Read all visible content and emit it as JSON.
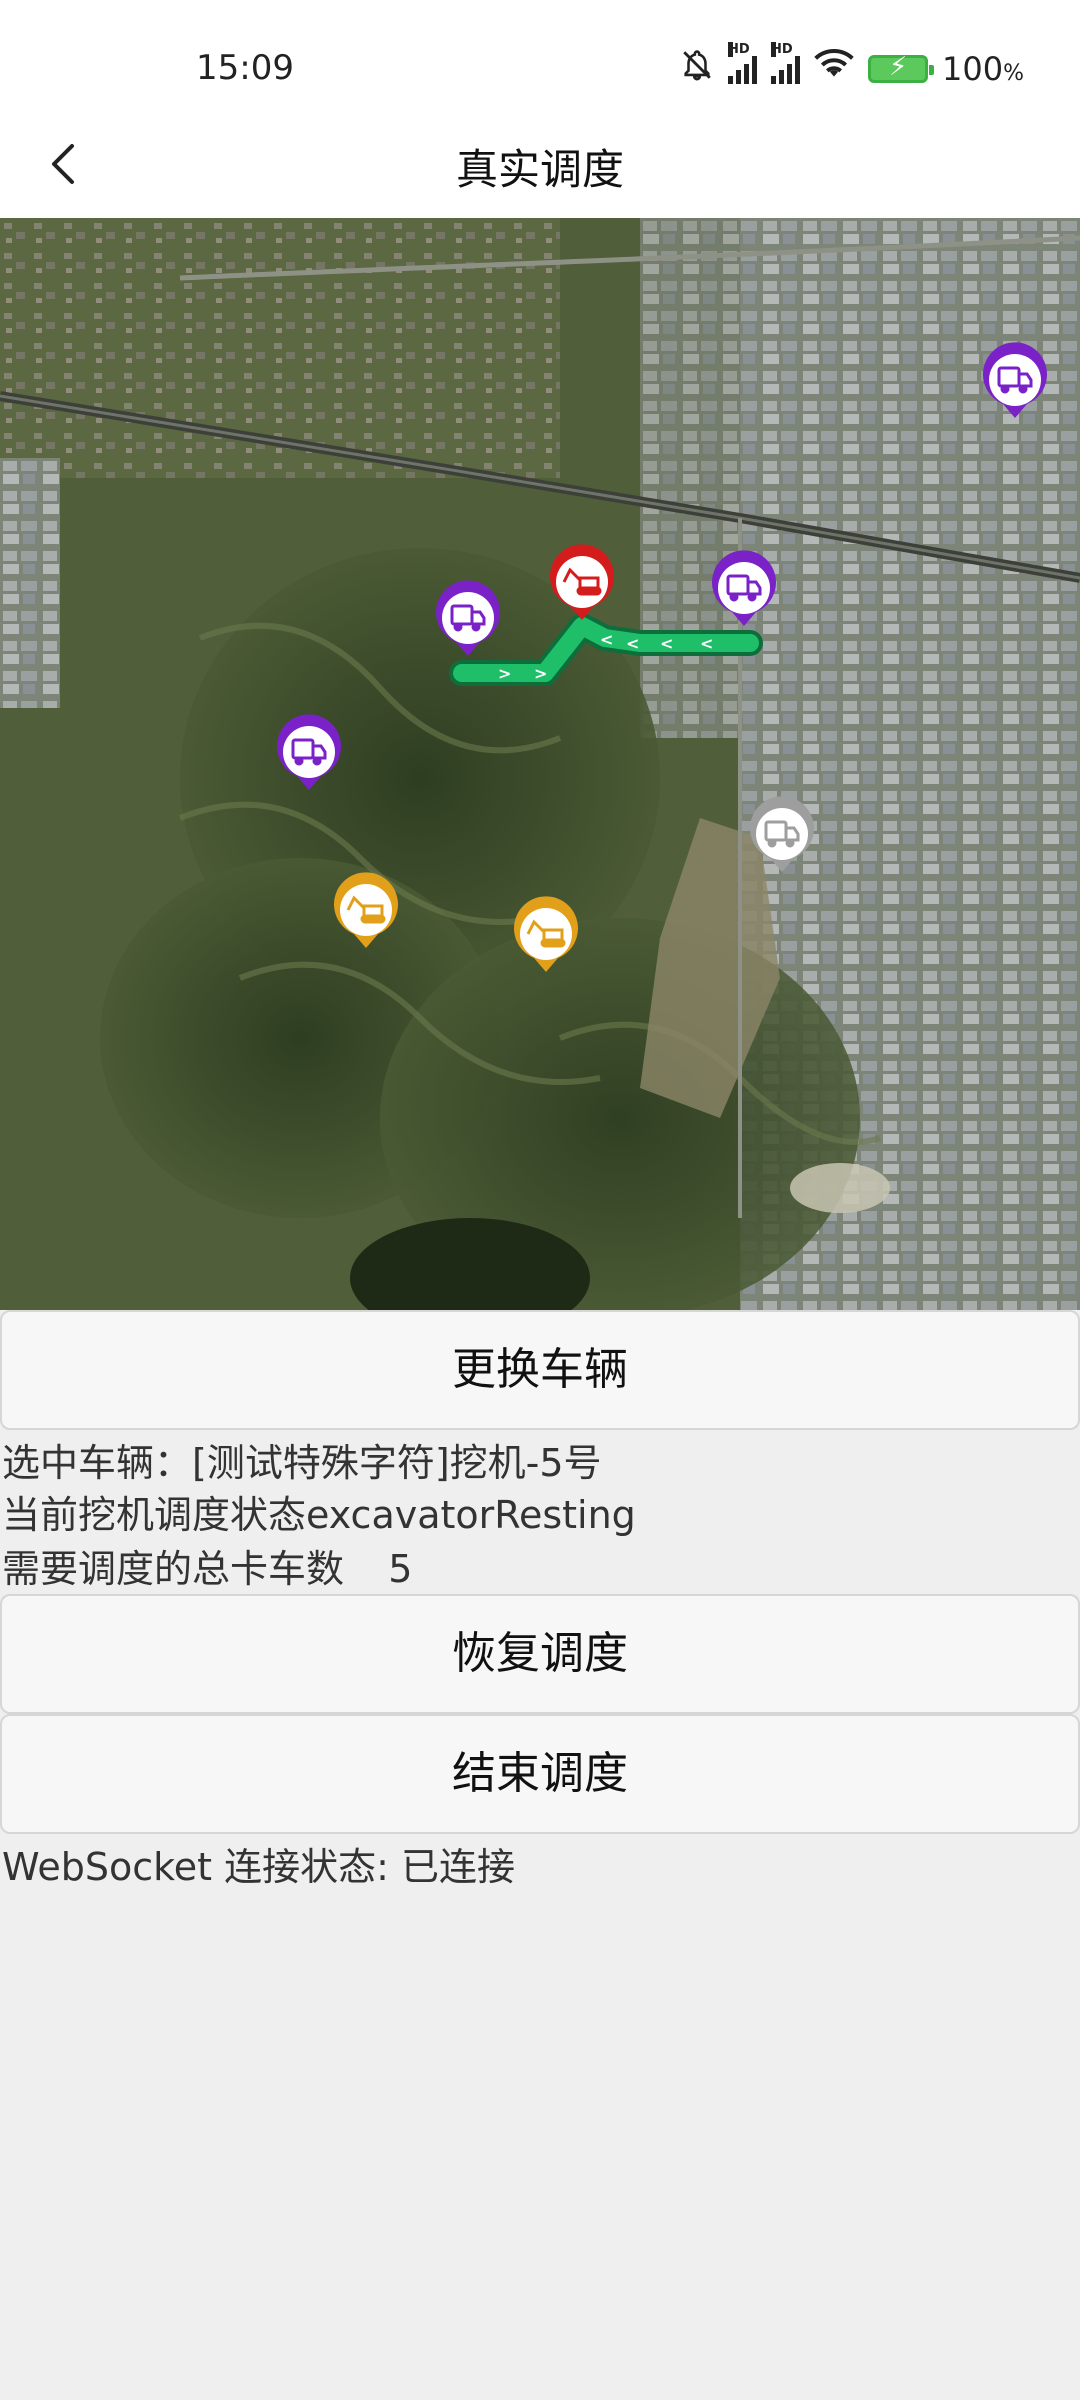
{
  "status_bar": {
    "time": "15:09",
    "battery_percent": "100",
    "battery_unit": "%",
    "icons": [
      "bell-off-icon",
      "hd-signal-icon",
      "hd-signal-icon",
      "wifi-icon",
      "battery-charging-icon"
    ]
  },
  "nav": {
    "title": "真实调度",
    "back_icon": "chevron-left-icon"
  },
  "map": {
    "markers": [
      {
        "type": "truck",
        "color": "#7a22c8"
      },
      {
        "type": "truck",
        "color": "#7a22c8"
      },
      {
        "type": "truck",
        "color": "#7a22c8"
      },
      {
        "type": "truck",
        "color": "#7a22c8"
      },
      {
        "type": "truck",
        "color": "#9e9e9e"
      },
      {
        "type": "excavator",
        "color": "#d41c1c"
      },
      {
        "type": "excavator",
        "color": "#e2a01a"
      },
      {
        "type": "excavator",
        "color": "#e2a01a"
      }
    ],
    "route_color": "#1fbf6a"
  },
  "buttons": {
    "change_vehicle": "更换车辆",
    "resume_dispatch": "恢复调度",
    "end_dispatch": "结束调度"
  },
  "info": {
    "selected_vehicle_label": "选中车辆：",
    "selected_vehicle_value": "[测试特殊字符]挖机-5号",
    "dispatch_status_label": "当前挖机调度状态",
    "dispatch_status_value": "excavatorResting",
    "total_trucks_label": "需要调度的总卡车数",
    "total_trucks_value": "5",
    "websocket_label": "WebSocket 连接状态: ",
    "websocket_value": "已连接"
  },
  "colors": {
    "background": "#efefef",
    "button_bg": "#f7f7f7",
    "truck_marker": "#7a22c8",
    "excavator_active": "#d41c1c",
    "excavator_idle": "#e2a01a",
    "truck_offline": "#9e9e9e"
  }
}
